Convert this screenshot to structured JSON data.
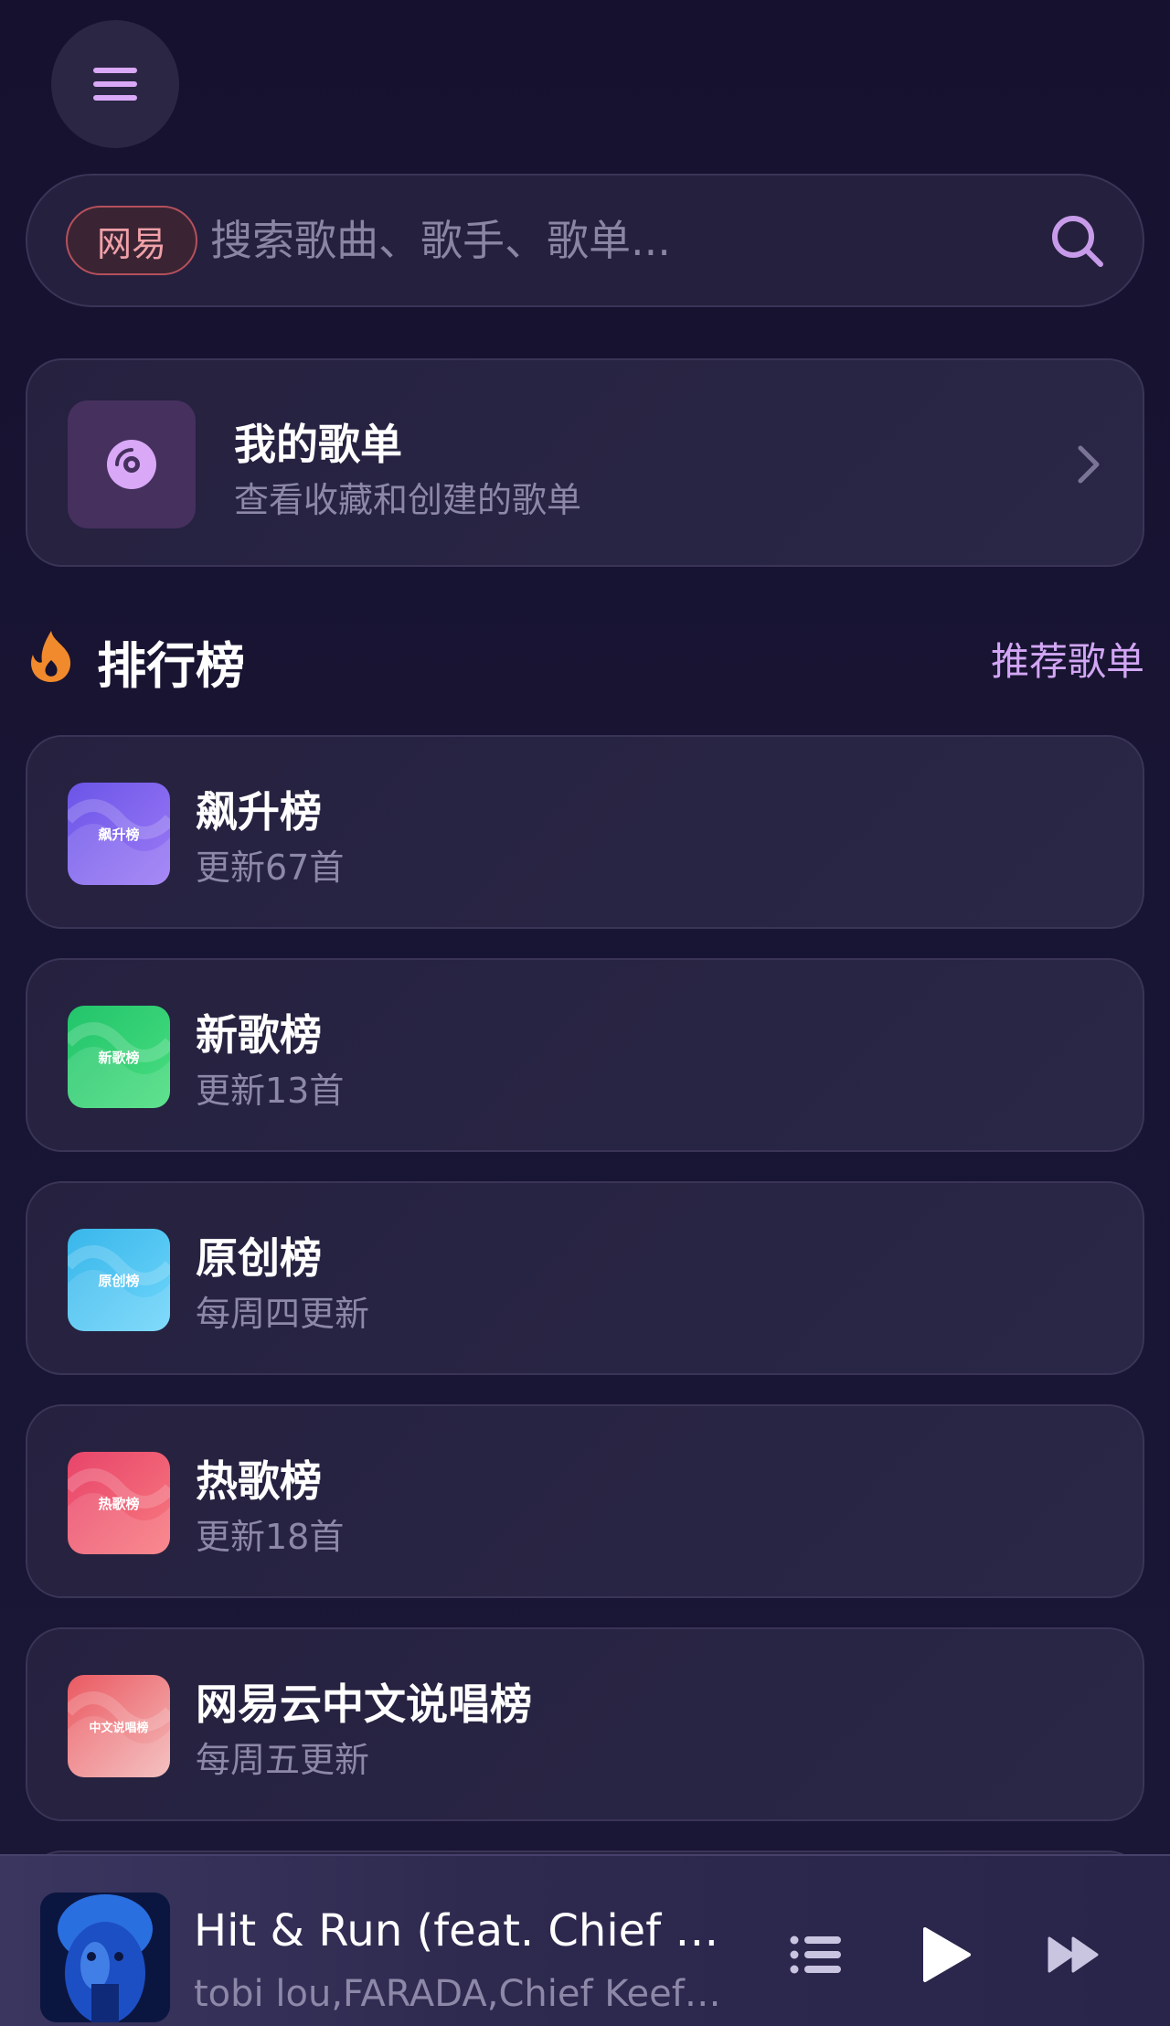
{
  "header": {
    "menu_icon": "menu-icon"
  },
  "search": {
    "source_chip": "网易",
    "placeholder": "搜索歌曲、歌手、歌单...",
    "value": "",
    "icon": "search-icon"
  },
  "my_playlists": {
    "title": "我的歌单",
    "subtitle": "查看收藏和创建的歌单",
    "icon": "disc-icon"
  },
  "charts_section": {
    "title": "排行榜",
    "link": "推荐歌单",
    "icon": "fire-icon"
  },
  "charts": [
    {
      "name": "飙升榜",
      "meta": "更新67首",
      "thumb_label": "飙升榜",
      "colors": [
        "#6b55e8",
        "#9c7af5"
      ]
    },
    {
      "name": "新歌榜",
      "meta": "更新13首",
      "thumb_label": "新歌榜",
      "colors": [
        "#22c46b",
        "#4ade80"
      ]
    },
    {
      "name": "原创榜",
      "meta": "每周四更新",
      "thumb_label": "原创榜",
      "colors": [
        "#38b6ea",
        "#6fd6fb"
      ]
    },
    {
      "name": "热歌榜",
      "meta": "更新18首",
      "thumb_label": "热歌榜",
      "colors": [
        "#e8456a",
        "#f87a80"
      ]
    },
    {
      "name": "网易云中文说唱榜",
      "meta": "每周五更新",
      "thumb_label": "中文说唱榜",
      "colors": [
        "#ea5a62",
        "#f4b8b8"
      ]
    }
  ],
  "player": {
    "title": "Hit & Run (feat. Chief Keef & BabyDrill)",
    "artist": "tobi lou,FARADA,Chief Keef,BabyDrill",
    "playlist_icon": "playlist-icon",
    "play_icon": "play-icon",
    "next_icon": "next-icon"
  }
}
